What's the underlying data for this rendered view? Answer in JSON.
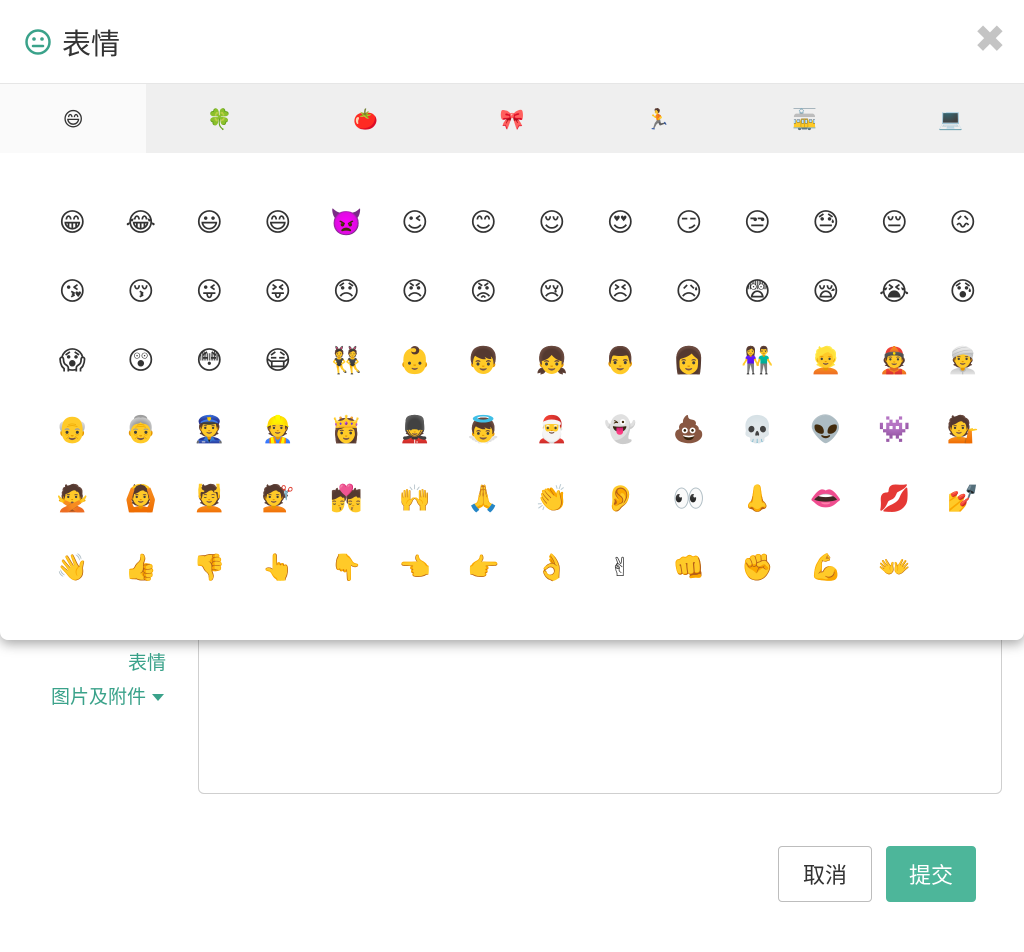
{
  "modal": {
    "title": "表情",
    "title_icon": "neutral-face-icon",
    "close_icon": "close-icon",
    "close_symbol": "✖",
    "accent_color": "#3aa28a"
  },
  "tabs": [
    {
      "name": "tab-smileys",
      "icon": "😄",
      "active": true
    },
    {
      "name": "tab-nature",
      "icon": "🍀",
      "active": false
    },
    {
      "name": "tab-food",
      "icon": "🍅",
      "active": false
    },
    {
      "name": "tab-objects",
      "icon": "🎀",
      "active": false
    },
    {
      "name": "tab-activity",
      "icon": "🏃",
      "active": false
    },
    {
      "name": "tab-travel",
      "icon": "🚋",
      "active": false
    },
    {
      "name": "tab-symbols",
      "icon": "💻",
      "active": false
    }
  ],
  "emojis": [
    "😁",
    "😂",
    "😃",
    "😄",
    "👿",
    "😉",
    "😊",
    "😌",
    "😍",
    "😏",
    "😒",
    "😓",
    "😔",
    "😖",
    "😘",
    "😚",
    "😜",
    "😝",
    "😞",
    "😠",
    "😡",
    "😢",
    "😣",
    "😥",
    "😨",
    "😪",
    "😭",
    "😰",
    "😱",
    "😲",
    "😳",
    "😷",
    "👯",
    "👶",
    "👦",
    "👧",
    "👨",
    "👩",
    "👫",
    "👱",
    "👲",
    "👳",
    "👴",
    "👵",
    "👮",
    "👷",
    "👸",
    "💂",
    "👼",
    "🎅",
    "👻",
    "💩",
    "💀",
    "👽",
    "👾",
    "💁",
    "🙅",
    "🙆",
    "💆",
    "💇",
    "💏",
    "🙌",
    "🙏",
    "👏",
    "👂",
    "👀",
    "👃",
    "👄",
    "💋",
    "💅",
    "👋",
    "👍",
    "👎",
    "👆",
    "👇",
    "👈",
    "👉",
    "👌",
    "✌",
    "👊",
    "✊",
    "💪",
    "👐"
  ],
  "form": {
    "emoji_link": "表情",
    "attach_link": "图片及附件",
    "cancel_label": "取消",
    "submit_label": "提交",
    "submit_color": "#4db69a"
  }
}
